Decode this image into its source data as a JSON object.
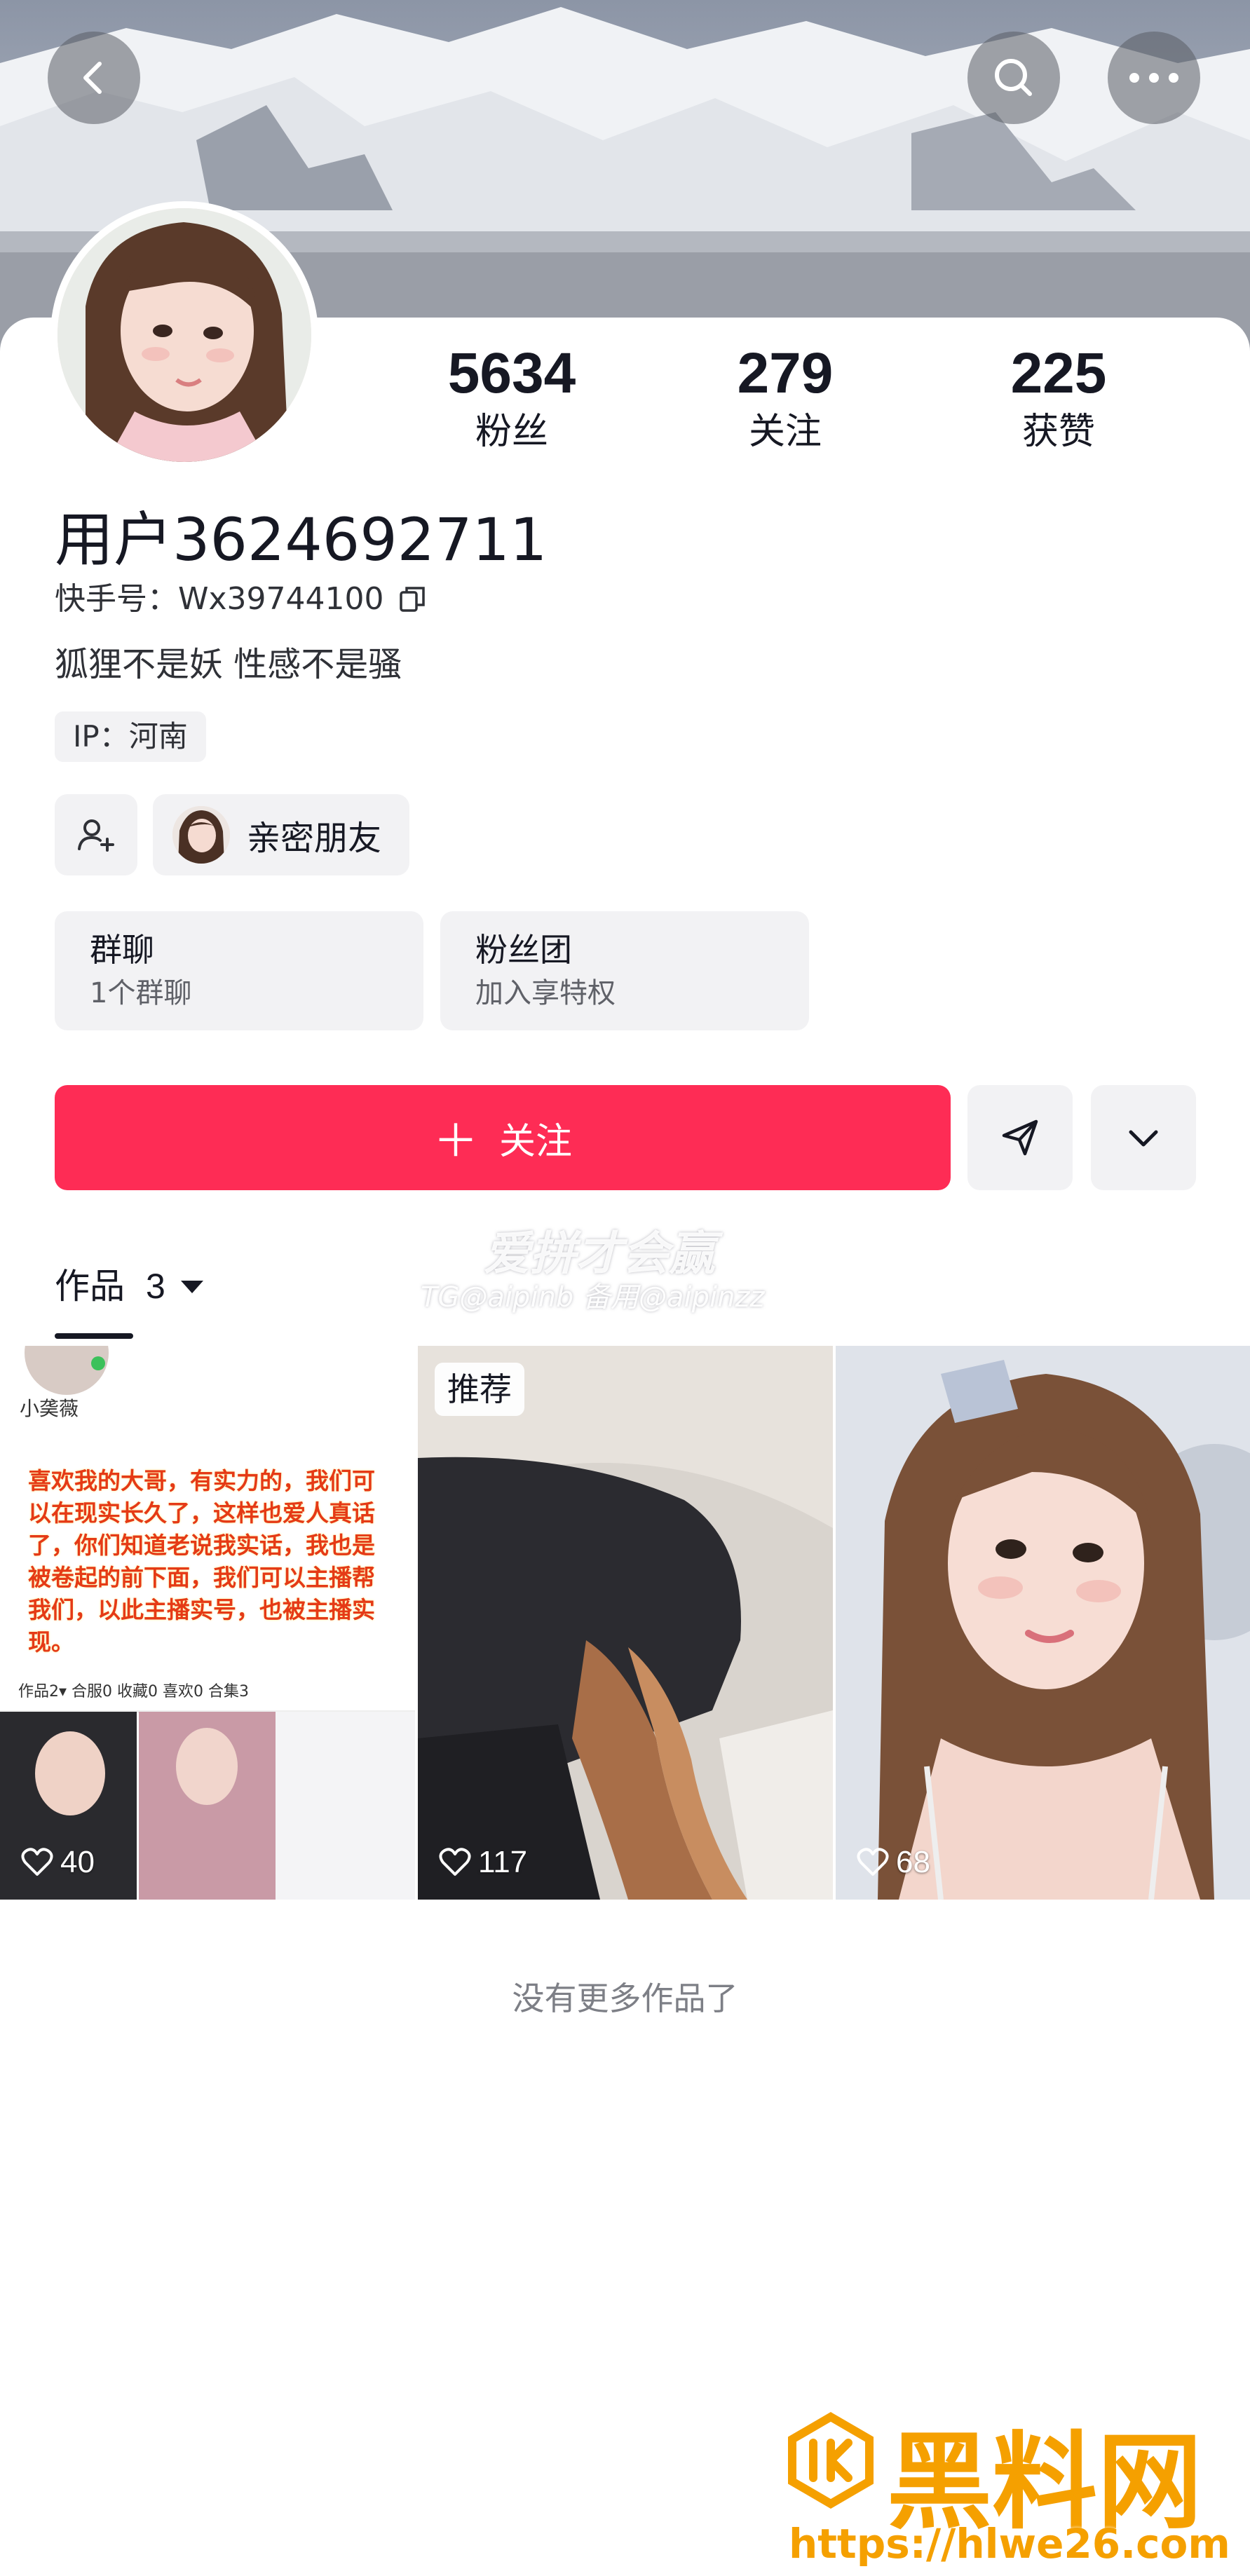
{
  "header": {
    "back_icon": "back-arrow-icon",
    "search_icon": "search-icon",
    "more_icon": "more-dots-icon"
  },
  "profile": {
    "stats": [
      {
        "value": "5634",
        "label": "粉丝"
      },
      {
        "value": "279",
        "label": "关注"
      },
      {
        "value": "225",
        "label": "获赞"
      }
    ],
    "username": "用户3624692711",
    "user_id": "快手号：Wx39744100",
    "bio": "狐狸不是妖 性感不是骚",
    "ip": "IP：河南"
  },
  "chips": {
    "friend_label": "亲密朋友"
  },
  "boxes": [
    {
      "title": "群聊",
      "subtitle": "1个群聊"
    },
    {
      "title": "粉丝团",
      "subtitle": "加入享特权"
    }
  ],
  "actions": {
    "follow_plus": "＋",
    "follow_label": "关注"
  },
  "watermark": {
    "line1": "爱拼才会赢",
    "line2": "TG@aipinb 备用@aipinzz"
  },
  "works": {
    "tab_label": "作品",
    "count": "3",
    "items": [
      {
        "likes": "40",
        "badge": ""
      },
      {
        "likes": "117",
        "badge": "推荐"
      },
      {
        "likes": "68",
        "badge": ""
      }
    ],
    "mock_text": {
      "name": "小䶮薇",
      "red_text": "喜欢我的大哥，有实力的，我们可以在现实长久了，这样也爱人真话了，你们知道老说我实话，我也是被卷起的前下面，我们可以主播帮我们，以此主播实号，也被主播实现。",
      "tabs": "作品2▾  合服0  收藏0  喜欢0  合集3"
    },
    "no_more": "没有更多作品了"
  },
  "brand": {
    "name": "黑料网",
    "url": "https://hlwe26.com"
  },
  "colors": {
    "accent": "#fe2c55",
    "brand": "#f5a000"
  }
}
